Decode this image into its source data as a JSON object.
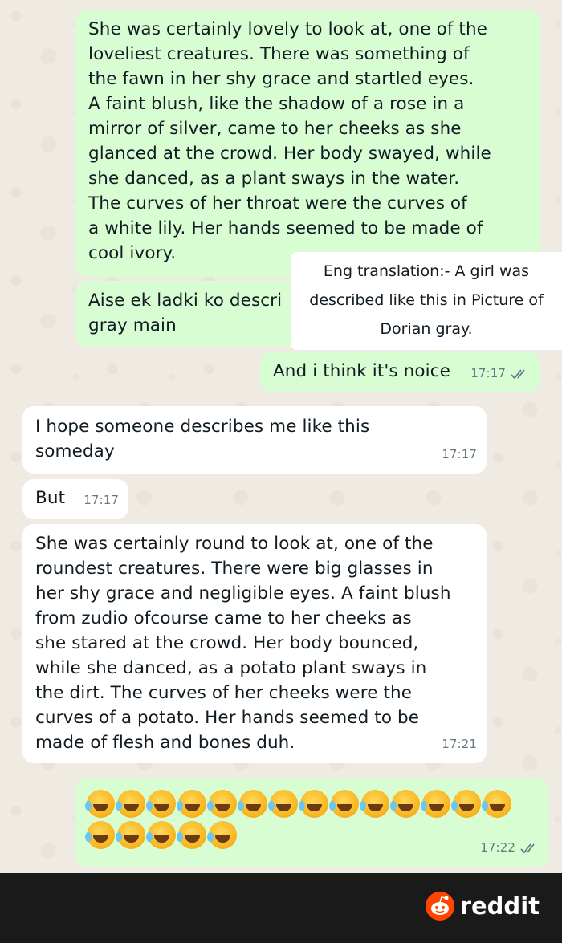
{
  "messages": [
    {
      "id": "m1",
      "direction": "outgoing",
      "text": "She was certainly lovely to look at, one of the\nloveliest creatures. There was something of\nthe fawn in her shy grace and startled eyes.\nA faint blush, like the shadow of a rose in a\nmirror of silver, came to her cheeks as she\nglanced at the crowd. Her body swayed, while\nshe danced, as a plant sways in the water.\nThe curves of her throat were the curves of\na white lily. Her hands seemed to be made of\ncool ivory."
    },
    {
      "id": "m2",
      "direction": "outgoing",
      "text": "Aise ek ladki ko descri\ngray main"
    },
    {
      "id": "m3",
      "direction": "outgoing",
      "text": "And i think it's noice",
      "time": "17:17",
      "read": true
    },
    {
      "id": "m4",
      "direction": "incoming",
      "text": "I hope someone describes me like this\nsomeday",
      "time": "17:17"
    },
    {
      "id": "m5",
      "direction": "incoming",
      "text": "But",
      "time": "17:17"
    },
    {
      "id": "m6",
      "direction": "incoming",
      "text": "She was certainly round to look at, one of the\nroundest creatures. There were big glasses in\nher shy grace and negligible eyes. A faint blush\nfrom zudio ofcourse came to her cheeks as\nshe stared at the crowd. Her body bounced,\nwhile she danced, as a potato plant sways in\nthe dirt. The curves of her cheeks were the\ncurves of a potato. Her hands seemed to be\nmade of flesh and bones duh.",
      "time": "17:21"
    },
    {
      "id": "m7",
      "direction": "outgoing",
      "emoji_name": "rolling-on-the-floor-laughing",
      "emoji_rows": [
        14,
        5
      ],
      "time": "17:22",
      "read": true
    }
  ],
  "translation_note": {
    "line1": "Eng translation:- A girl was",
    "line2": "described like this in Picture of",
    "line3": "Dorian gray."
  },
  "footer": {
    "brand": "reddit",
    "icon": "reddit-snoo-icon"
  },
  "colors": {
    "outgoing_bubble": "#d9fdd3",
    "incoming_bubble": "#ffffff",
    "chat_background": "#efeae2",
    "footer_background": "#1a1a1b",
    "reddit_orange": "#ff4500",
    "timestamp": "#667781"
  }
}
